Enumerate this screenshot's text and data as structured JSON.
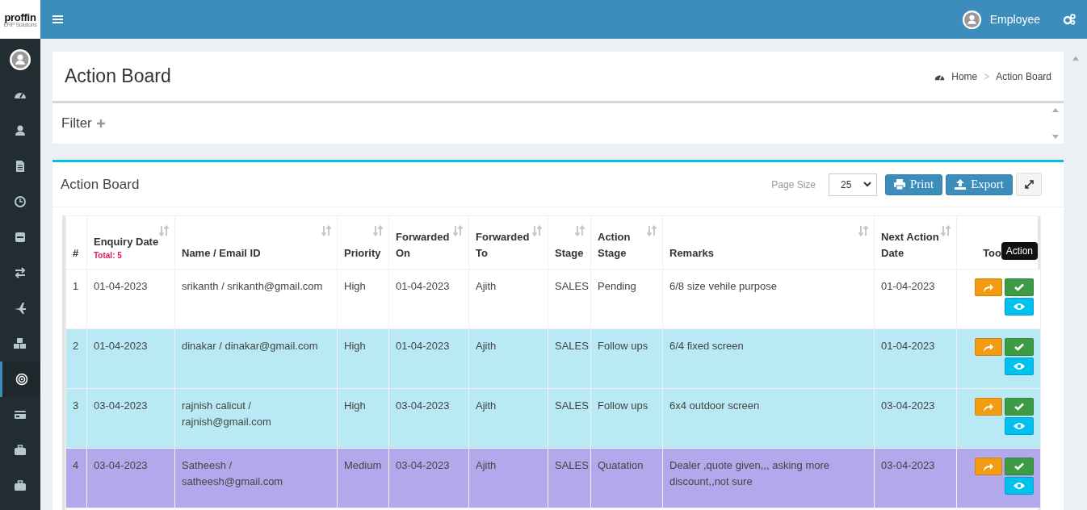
{
  "app": {
    "logo": "proffin",
    "tagline": "ERP Solutions",
    "user": "Employee"
  },
  "sidebar": {
    "items": [
      {
        "selected": false
      },
      {
        "selected": false
      },
      {
        "selected": false
      },
      {
        "selected": false
      },
      {
        "selected": false
      },
      {
        "selected": false
      },
      {
        "selected": false
      },
      {
        "selected": false
      },
      {
        "selected": true
      },
      {
        "selected": false
      },
      {
        "selected": false
      },
      {
        "selected": false
      }
    ]
  },
  "page": {
    "title": "Action Board",
    "breadcrumb": [
      "Home",
      "Action Board"
    ],
    "breadcrumb_separator": ">"
  },
  "filter": {
    "label": "Filter"
  },
  "board": {
    "title": "Action Board",
    "page_size_label": "Page Size",
    "page_size": "25",
    "buttons": [
      {
        "kind": "print",
        "label": "Print"
      },
      {
        "kind": "export",
        "label": "Export"
      }
    ],
    "tooltip": "Action",
    "table": {
      "total": "Total: 5",
      "columns": [
        {
          "label": "#",
          "sortable": false
        },
        {
          "label": "Enquiry Date",
          "sortable": true
        },
        {
          "label": "Name / Email ID",
          "sortable": true
        },
        {
          "label": "Priority",
          "sortable": true
        },
        {
          "label": "Forwarded On",
          "sortable": true
        },
        {
          "label": "Forwarded To",
          "sortable": true
        },
        {
          "label": "Stage",
          "sortable": true
        },
        {
          "label": "Action Stage",
          "sortable": true
        },
        {
          "label": "Remarks",
          "sortable": true
        },
        {
          "label": "Next Action Date",
          "sortable": true
        },
        {
          "label": "Too",
          "sortable": false
        }
      ],
      "rows": [
        {
          "color": "#ffffff",
          "cells": [
            "1",
            "01-04-2023",
            "srikanth / srikanth@gmail.com",
            "High",
            "01-04-2023",
            "Ajith",
            "SALES",
            "Pending",
            "6/8 size vehile purpose",
            "01-04-2023"
          ]
        },
        {
          "color": "#b8e9f5",
          "cells": [
            "2",
            "01-04-2023",
            "dinakar / dinakar@gmail.com",
            "High",
            "01-04-2023",
            "Ajith",
            "SALES",
            "Follow ups",
            "6/4 fixed screen",
            "01-04-2023"
          ]
        },
        {
          "color": "#b8e9f5",
          "cells": [
            "3",
            "03-04-2023",
            "rajnish calicut / rajnish@gmail.com",
            "High",
            "03-04-2023",
            "Ajith",
            "SALES",
            "Follow ups",
            "6x4 outdoor screen",
            "03-04-2023"
          ]
        },
        {
          "color": "#b2a9ec",
          "cells": [
            "4",
            "03-04-2023",
            "Satheesh / satheesh@gmail.com",
            "Medium",
            "03-04-2023",
            "Ajith",
            "SALES",
            "Quatation",
            "Dealer ,quote given,,, asking more discount,,not sure",
            "03-04-2023"
          ]
        }
      ]
    }
  }
}
